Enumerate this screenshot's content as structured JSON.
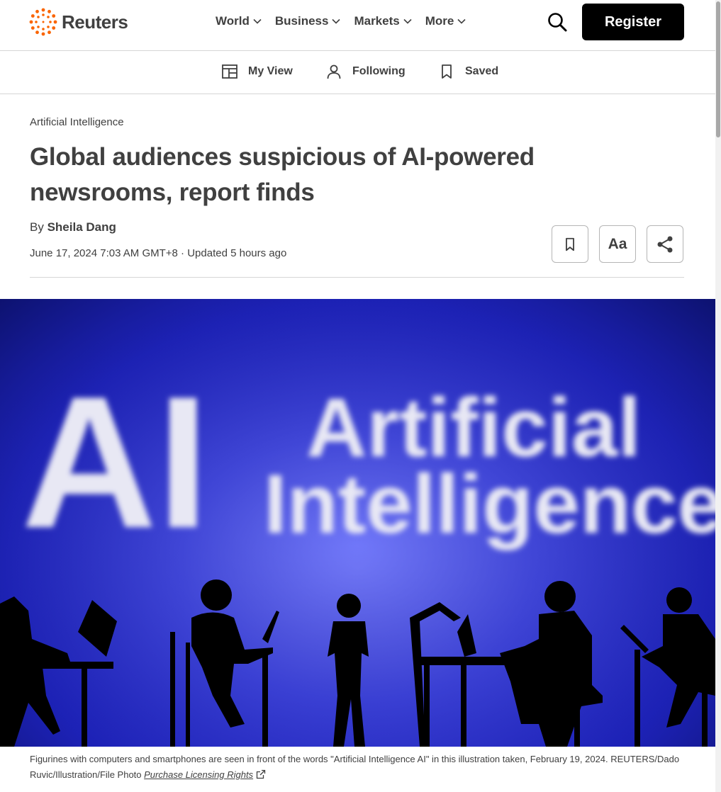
{
  "brand": {
    "name": "Reuters",
    "accent": "#fa6400"
  },
  "header": {
    "nav": [
      {
        "label": "World"
      },
      {
        "label": "Business"
      },
      {
        "label": "Markets"
      },
      {
        "label": "More"
      }
    ],
    "register_label": "Register"
  },
  "subnav": {
    "items": [
      {
        "label": "My View",
        "icon": "layout-icon"
      },
      {
        "label": "Following",
        "icon": "person-icon"
      },
      {
        "label": "Saved",
        "icon": "bookmark-icon"
      }
    ]
  },
  "article": {
    "kicker": "Artificial Intelligence",
    "headline": "Global audiences suspicious of AI-powered newsrooms, report finds",
    "byline_prefix": "By",
    "author": "Sheila Dang",
    "dateline": "June 17, 2024 7:03 AM GMT+8 · Updated 5 hours ago",
    "tools": {
      "text_size_label": "Aa"
    },
    "image": {
      "text_large": "AI",
      "text_line1": "Artificial",
      "text_line2": "Intelligence"
    },
    "caption": "Figurines with computers and smartphones are seen in front of the words \"Artificial Intelligence AI\" in this illustration taken, February 19, 2024. REUTERS/Dado Ruvic/Illustration/File Photo",
    "rights_label": "Purchase Licensing Rights"
  }
}
